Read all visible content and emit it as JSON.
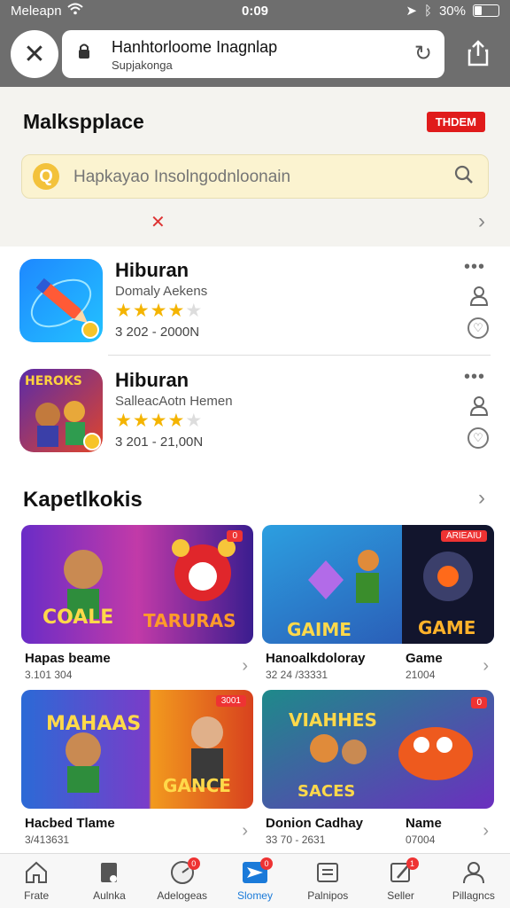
{
  "status_bar": {
    "carrier": "Meleapn",
    "time": "0:09",
    "battery": "30%",
    "battery_level": 0.3
  },
  "browser": {
    "url_title": "Hanhtorloome Inagnlap",
    "url_sub": "Supjakonga",
    "icons": [
      "close-icon",
      "lock-icon",
      "reload-icon",
      "share-icon"
    ]
  },
  "marketplace": {
    "title": "Malkspplace",
    "badge": "THDEM",
    "search_placeholder": "Hapkayao Insolngodnloonain"
  },
  "apps": [
    {
      "name": "Hiburan",
      "subtitle": "Domaly Aekens",
      "rating": 4,
      "max_rating": 5,
      "meta": "3 202 -  2000N"
    },
    {
      "name": "Hiburan",
      "subtitle": "SalleacAotn Hemen",
      "rating": 4,
      "max_rating": 5,
      "meta": "3 201 -  21,00N",
      "icon_text": "HEROKS"
    }
  ],
  "section": {
    "title": "Kapetlkokis",
    "cards": [
      {
        "title": "Hapas beame",
        "meta": "3.101 304",
        "banner_text_1": "COALE",
        "banner_text_2": "TARURAS",
        "banner_badge": "0"
      },
      {
        "title": "Hanoalkdoloray",
        "meta": "32 24 /33331",
        "title2": "Game",
        "meta2": "21004",
        "banner_text_1": "GAIME",
        "banner_text_2": "GAME",
        "banner_badge": "ARIEAIU"
      },
      {
        "title": "Hacbed Tlame",
        "meta": "3/413631",
        "banner_text_1": "MAHAAS",
        "banner_text_2": "GANCE",
        "banner_badge": "3001"
      },
      {
        "title": "Donion Cadhay",
        "meta": "33 70 - 2631",
        "title2": "Name",
        "meta2": "07004",
        "banner_text_1": "VIAHHES",
        "banner_text_2": "SACES",
        "banner_badge": "0"
      }
    ]
  },
  "tabs": [
    {
      "label": "Frate",
      "icon": "home-icon"
    },
    {
      "label": "Aulnka",
      "icon": "tag-icon"
    },
    {
      "label": "Adelogeas",
      "icon": "gauge-icon",
      "badge": "0"
    },
    {
      "label": "Slomey",
      "icon": "send-icon",
      "badge": "0",
      "active": true
    },
    {
      "label": "Palnipos",
      "icon": "list-icon"
    },
    {
      "label": "Seller",
      "icon": "edit-icon",
      "badge": "1"
    },
    {
      "label": "Pillagncs",
      "icon": "profile-icon"
    }
  ],
  "colors": {
    "accent": "#1a7ad9",
    "badge_red": "#e01b1b",
    "star": "#f4b400",
    "search_bg": "#fbf3d0"
  }
}
